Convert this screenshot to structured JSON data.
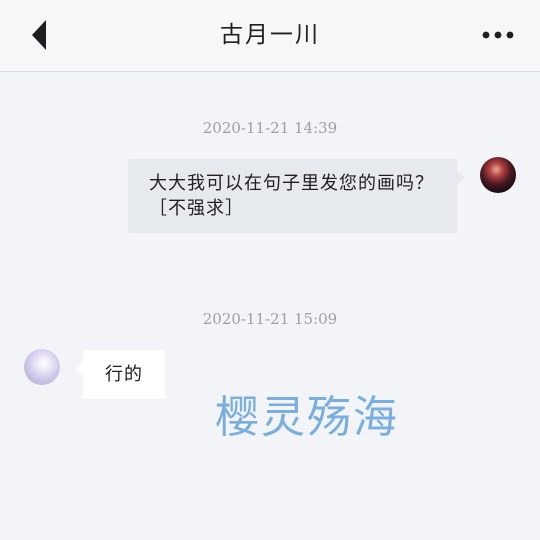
{
  "header": {
    "title": "古月一川",
    "back_icon": "chevron-left-icon",
    "more_icon": "more-horizontal-icon"
  },
  "messages": [
    {
      "timestamp": "2020-11-21 14:39",
      "direction": "outgoing",
      "text": "大大我可以在句子里发您的画吗？［不强求］"
    },
    {
      "timestamp": "2020-11-21 15:09",
      "direction": "incoming",
      "text": "行的"
    }
  ],
  "watermark": "樱灵殇海",
  "colors": {
    "background": "#f3f4f8",
    "outgoing_bubble": "#e6eaef",
    "incoming_bubble": "#ffffff",
    "watermark": "#78aee0"
  }
}
